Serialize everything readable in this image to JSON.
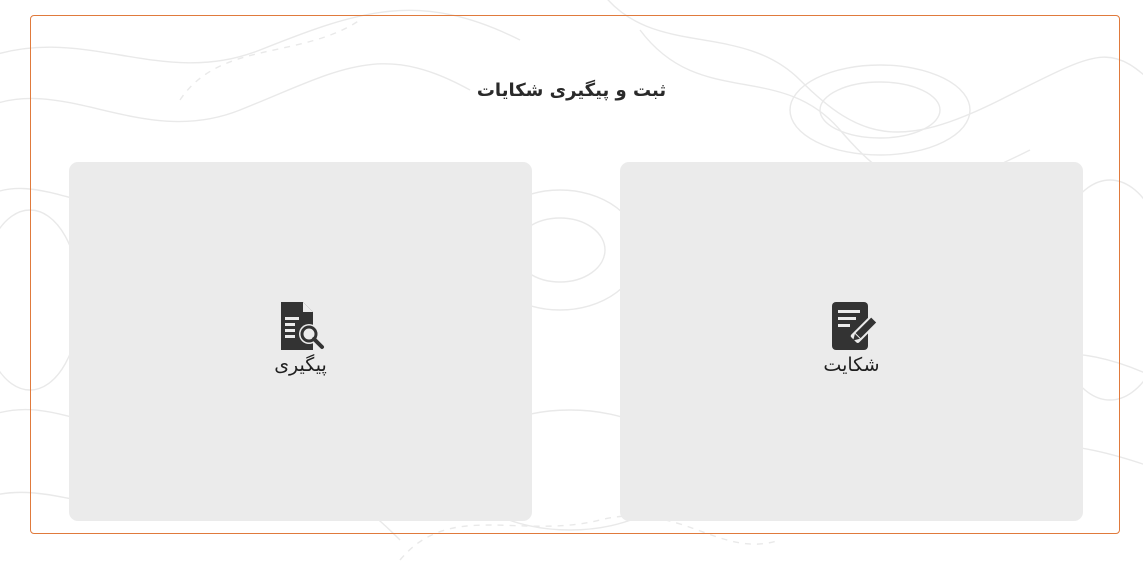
{
  "page": {
    "title": "ثبت و پیگیری شکایات"
  },
  "cards": [
    {
      "id": "complaint",
      "label": "شکایت",
      "icon": "document-pen-icon"
    },
    {
      "id": "followup",
      "label": "پیگیری",
      "icon": "document-search-icon"
    }
  ],
  "colors": {
    "frame_border": "#e07a3c",
    "card_background": "#ebebeb",
    "icon_color": "#333333",
    "text_color": "#2a2a2a"
  }
}
